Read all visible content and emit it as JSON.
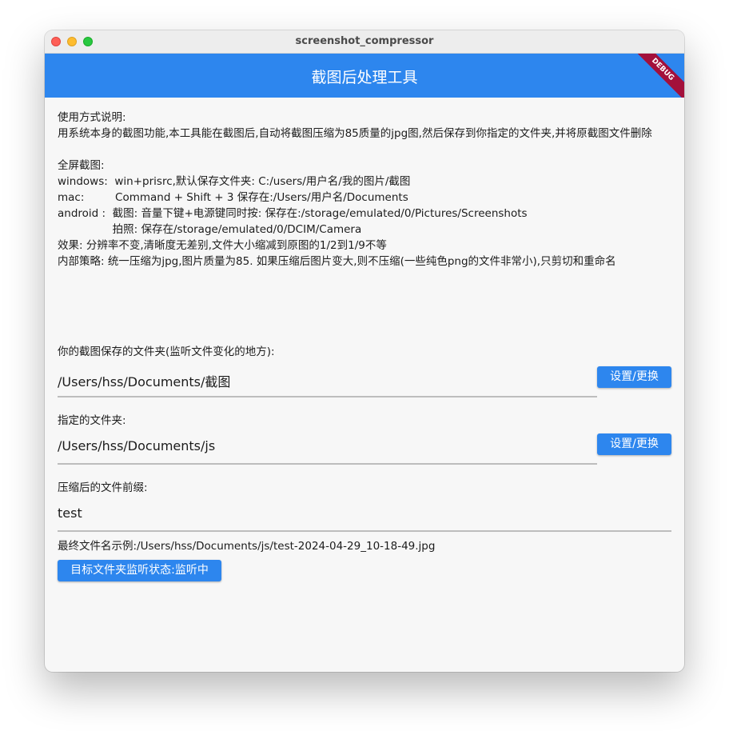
{
  "window": {
    "title": "screenshot_compressor"
  },
  "appbar": {
    "title": "截图后处理工具",
    "debug_banner": "DEBUG"
  },
  "instructions": {
    "heading": "使用方式说明:",
    "description": "用系统本身的截图功能,本工具能在截图后,自动将截图压缩为85质量的jpg图,然后保存到你指定的文件夹,并将原截图文件删除",
    "fullscreen_heading": "全屏截图:",
    "windows_line": "windows:  win+prisrc,默认保存文件夹: C:/users/用户名/我的图片/截图",
    "mac_line": "mac:         Command + Shift + 3 保存在:/Users/用户名/Documents",
    "android_line": "android :  截图: 音量下键+电源键同时按: 保存在:/storage/emulated/0/Pictures/Screenshots",
    "android_camera_line": "                拍照: 保存在/storage/emulated/0/DCIM/Camera",
    "effect_line": "效果: 分辨率不变,清晰度无差别,文件大小缩减到原图的1/2到1/9不等",
    "strategy_line": "内部策略: 统一压缩为jpg,图片质量为85. 如果压缩后图片变大,则不压缩(一些纯色png的文件非常小),只剪切和重命名"
  },
  "source_folder": {
    "label": "你的截图保存的文件夹(监听文件变化的地方):",
    "value": "/Users/hss/Documents/截图",
    "button": "设置/更换"
  },
  "target_folder": {
    "label": "指定的文件夹:",
    "value": "/Users/hss/Documents/js",
    "button": "设置/更换"
  },
  "prefix": {
    "label": "压缩后的文件前缀:",
    "value": "test"
  },
  "example": {
    "text": "最终文件名示例:/Users/hss/Documents/js/test-2024-04-29_10-18-49.jpg"
  },
  "monitor": {
    "button": "目标文件夹监听状态:监听中"
  },
  "colors": {
    "accent": "#2d86ee",
    "debug": "#a3103b",
    "background": "#f7f7f7"
  }
}
